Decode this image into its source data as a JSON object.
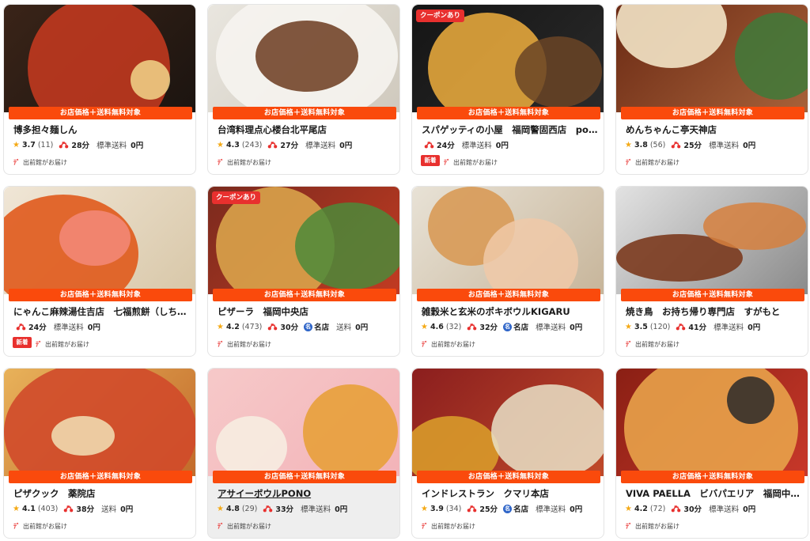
{
  "labels": {
    "promo": "お店価格＋送料無料対象",
    "coupon": "クーポンあり",
    "new": "新着",
    "delivery": "出前館がお届け",
    "delivery_icon": "ﾃﾞ",
    "star": "★",
    "meisten_icon": "名",
    "meisten": "名店"
  },
  "colors": {
    "accent": "#fa4a0c",
    "badge": "#e8302e",
    "star": "#f4a915",
    "meisten": "#2d64c8"
  },
  "icons": {
    "rating": "star-icon",
    "delivery_time": "motorbike-icon",
    "carrier": "demae-logo-icon",
    "famous": "meisten-icon"
  },
  "cards": [
    {
      "name": "博多担々麺しん",
      "rating": "3.7",
      "count": "(11)",
      "time": "28分",
      "fee_label": "標準送料",
      "fee": "0円",
      "coupon": false,
      "new": false,
      "meisten": false,
      "image": "dandan noodles with egg"
    },
    {
      "name": "台湾料理点心楼台北平尾店",
      "rating": "4.3",
      "count": "(243)",
      "time": "27分",
      "fee_label": "標準送料",
      "fee": "0円",
      "coupon": false,
      "new": false,
      "meisten": false,
      "image": "stir-fried pork and vegetables"
    },
    {
      "name": "スパゲッティの小屋　福岡警固西店　po…",
      "rating": "",
      "count": "",
      "time": "24分",
      "fee_label": "標準送料",
      "fee": "0円",
      "coupon": true,
      "new": true,
      "meisten": false,
      "image": "spaghetti with meat"
    },
    {
      "name": "めんちゃんこ亭天神店",
      "rating": "3.8",
      "count": "(56)",
      "time": "25分",
      "fee_label": "標準送料",
      "fee": "0円",
      "coupon": false,
      "new": false,
      "meisten": false,
      "image": "nabe hot pot set"
    },
    {
      "name": "にゃんこ麻辣湯住吉店　七福煎餅（しち…",
      "rating": "",
      "count": "",
      "time": "24分",
      "fee_label": "標準送料",
      "fee": "0円",
      "coupon": false,
      "new": true,
      "meisten": false,
      "image": "mala noodles with shrimp"
    },
    {
      "name": "ピザーラ　福岡中央店",
      "rating": "4.2",
      "count": "(473)",
      "time": "30分",
      "fee_label": "送料",
      "fee": "0円",
      "coupon": true,
      "new": false,
      "meisten": true,
      "image": "assorted pizzas"
    },
    {
      "name": "雑穀米と玄米のポキボウルKIGARU",
      "rating": "4.6",
      "count": "(32)",
      "time": "32分",
      "fee_label": "標準送料",
      "fee": "0円",
      "coupon": false,
      "new": false,
      "meisten": true,
      "image": "poke bowls"
    },
    {
      "name": "焼き鳥　お持ち帰り専門店　すがもと",
      "rating": "3.5",
      "count": "(120)",
      "time": "41分",
      "fee_label": "標準送料",
      "fee": "0円",
      "coupon": false,
      "new": false,
      "meisten": false,
      "image": "yakitori skewers"
    },
    {
      "name": "ピザクック　薬院店",
      "rating": "4.1",
      "count": "(403)",
      "time": "38分",
      "fee_label": "送料",
      "fee": "0円",
      "coupon": false,
      "new": false,
      "meisten": false,
      "image": "pepperoni pizza"
    },
    {
      "name": "アサイーボウルPONO",
      "rating": "4.8",
      "count": "(29)",
      "time": "33分",
      "fee_label": "標準送料",
      "fee": "0円",
      "coupon": false,
      "new": false,
      "meisten": false,
      "hover": true,
      "image": "acai bowls and drinks"
    },
    {
      "name": "インドレストラン　クマリ本店",
      "rating": "3.9",
      "count": "(34)",
      "time": "25分",
      "fee_label": "標準送料",
      "fee": "0円",
      "coupon": false,
      "new": false,
      "meisten": true,
      "image": "curry and naan"
    },
    {
      "name": "VIVA PAELLA　ビバパエリア　福岡中…",
      "rating": "4.2",
      "count": "(72)",
      "time": "30分",
      "fee_label": "標準送料",
      "fee": "0円",
      "coupon": false,
      "new": false,
      "meisten": false,
      "image": "seafood paella"
    }
  ]
}
